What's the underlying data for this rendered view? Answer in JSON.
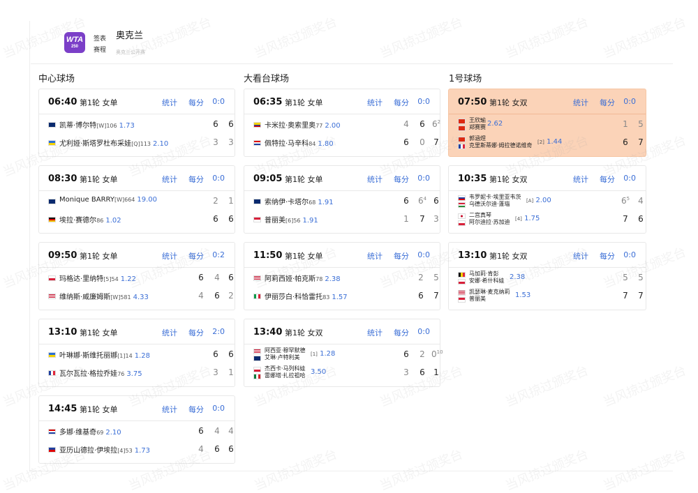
{
  "header": {
    "logo_text": "WTA",
    "logo_sub": "250",
    "nav": [
      "签表",
      "赛程"
    ],
    "title": "奥克兰",
    "subtitle": "奥克兰公开赛"
  },
  "watermark": "当风掠过颁奖台",
  "colors": {
    "link": "#3a6ed6",
    "highlight": "#fbd3b8",
    "logo": "#7b3fc8"
  },
  "links": {
    "stats": "统计",
    "points": "每分"
  },
  "courts": [
    {
      "name": "中心球场",
      "matches": [
        {
          "time": "06:40",
          "round": "第1轮 女单",
          "score": "0:0",
          "p1": {
            "flag": "GB",
            "name": "凯蒂·博尔特",
            "seed": "[W]",
            "rank": "106",
            "odds": "1.73",
            "sets": [
              {
                "v": "6"
              },
              {
                "v": "6"
              }
            ]
          },
          "p2": {
            "flag": "UA",
            "name": "尤利娅·斯塔罗杜布采娃",
            "seed": "[Q]",
            "rank": "113",
            "odds": "2.10",
            "sets": [
              {
                "v": "3",
                "dim": true
              },
              {
                "v": "3",
                "dim": true
              }
            ]
          }
        },
        {
          "time": "08:30",
          "round": "第1轮 女单",
          "score": "0:0",
          "p1": {
            "flag": "NZ",
            "name": "Monique BARRY",
            "seed": "[W]",
            "rank": "664",
            "odds": "19.00",
            "sets": [
              {
                "v": "2",
                "dim": true
              },
              {
                "v": "1",
                "dim": true
              }
            ]
          },
          "p2": {
            "flag": "DE",
            "name": "埃拉·赛德尔",
            "seed": "",
            "rank": "86",
            "odds": "1.02",
            "sets": [
              {
                "v": "6"
              },
              {
                "v": "6"
              }
            ]
          }
        },
        {
          "time": "09:50",
          "round": "第1轮 女单",
          "score": "0:2",
          "p1": {
            "flag": "PL",
            "name": "玛格达·里纳特",
            "seed": "[5]",
            "rank": "54",
            "odds": "1.22",
            "sets": [
              {
                "v": "6"
              },
              {
                "v": "4",
                "dim": true
              },
              {
                "v": "6"
              }
            ]
          },
          "p2": {
            "flag": "US",
            "name": "维纳斯·威廉姆斯",
            "seed": "[W]",
            "rank": "581",
            "odds": "4.33",
            "sets": [
              {
                "v": "4",
                "dim": true
              },
              {
                "v": "6"
              },
              {
                "v": "2",
                "dim": true
              }
            ]
          }
        },
        {
          "time": "13:10",
          "round": "第1轮 女单",
          "score": "2:0",
          "p1": {
            "flag": "UA",
            "name": "叶琳娜·斯维托丽娜",
            "seed": "[1]",
            "rank": "14",
            "odds": "1.28",
            "sets": [
              {
                "v": "6"
              },
              {
                "v": "6"
              }
            ]
          },
          "p2": {
            "flag": "FR",
            "name": "瓦尔瓦拉·格拉乔娃",
            "seed": "",
            "rank": "76",
            "odds": "3.75",
            "sets": [
              {
                "v": "3",
                "dim": true
              },
              {
                "v": "1",
                "dim": true
              }
            ]
          }
        },
        {
          "time": "14:45",
          "round": "第1轮 女单",
          "score": "0:0",
          "p1": {
            "flag": "HR",
            "name": "多娜·维基奇",
            "seed": "",
            "rank": "69",
            "odds": "2.10",
            "sets": [
              {
                "v": "6"
              },
              {
                "v": "4",
                "dim": true
              },
              {
                "v": "4",
                "dim": true
              }
            ]
          },
          "p2": {
            "flag": "PH",
            "name": "亚历山德拉·伊埃拉",
            "seed": "[4]",
            "rank": "53",
            "odds": "1.73",
            "sets": [
              {
                "v": "4",
                "dim": true
              },
              {
                "v": "6"
              },
              {
                "v": "6"
              }
            ]
          }
        }
      ]
    },
    {
      "name": "大看台球场",
      "matches": [
        {
          "time": "06:35",
          "round": "第1轮 女单",
          "score": "0:0",
          "p1": {
            "flag": "CO",
            "name": "卡米拉·奥索里奥",
            "seed": "",
            "rank": "77",
            "odds": "2.00",
            "sets": [
              {
                "v": "4",
                "dim": true
              },
              {
                "v": "6"
              },
              {
                "v": "6",
                "sup": "2",
                "dim": true
              }
            ]
          },
          "p2": {
            "flag": "HR",
            "name": "佩特拉·马辛科",
            "seed": "",
            "rank": "84",
            "odds": "1.80",
            "sets": [
              {
                "v": "6"
              },
              {
                "v": "0",
                "dim": true
              },
              {
                "v": "7"
              }
            ]
          }
        },
        {
          "time": "09:05",
          "round": "第1轮 女单",
          "score": "0:0",
          "p1": {
            "flag": "GB",
            "name": "索纳伊·卡塔尔",
            "seed": "",
            "rank": "68",
            "odds": "1.91",
            "sets": [
              {
                "v": "6"
              },
              {
                "v": "6",
                "sup": "4",
                "dim": true
              },
              {
                "v": "6"
              }
            ]
          },
          "p2": {
            "flag": "ID",
            "name": "普丽美",
            "seed": "[6]",
            "rank": "56",
            "odds": "1.91",
            "sets": [
              {
                "v": "1",
                "dim": true
              },
              {
                "v": "7"
              },
              {
                "v": "3",
                "dim": true
              }
            ]
          }
        },
        {
          "time": "11:50",
          "round": "第1轮 女单",
          "score": "0:0",
          "p1": {
            "flag": "US",
            "name": "阿莉西娅·帕克斯",
            "seed": "",
            "rank": "78",
            "odds": "2.38",
            "sets": [
              {
                "v": "2",
                "dim": true
              },
              {
                "v": "5",
                "dim": true
              }
            ]
          },
          "p2": {
            "flag": "IT",
            "name": "伊丽莎白·科恰雷托",
            "seed": "",
            "rank": "83",
            "odds": "1.57",
            "sets": [
              {
                "v": "6"
              },
              {
                "v": "7"
              }
            ]
          }
        },
        {
          "time": "13:40",
          "round": "第1轮 女双",
          "score": "0:0",
          "doubles": true,
          "p1": {
            "flags": [
              "US",
              "NZ"
            ],
            "names": [
              "阿西亚·穆罕默德",
              "艾琳·卢特利美"
            ],
            "seed": "[1]",
            "odds": "1.28",
            "sets": [
              {
                "v": "6"
              },
              {
                "v": "2",
                "dim": true
              },
              {
                "v": "0",
                "sup": "10",
                "dim": true
              }
            ]
          },
          "p2": {
            "flags": [
              "CZ",
              "MX"
            ],
            "names": [
              "杰西卡·马列科娃",
              "雷娜塔·扎拉祖哈"
            ],
            "seed": "",
            "odds": "3.50",
            "sets": [
              {
                "v": "3",
                "dim": true
              },
              {
                "v": "6"
              },
              {
                "v": "1"
              }
            ]
          }
        }
      ]
    },
    {
      "name": "1号球场",
      "matches": [
        {
          "time": "07:50",
          "round": "第1轮 女双",
          "score": "0:0",
          "doubles": true,
          "highlight": true,
          "p1": {
            "flags": [
              "CN",
              "CN"
            ],
            "names": [
              "王欣瑜",
              "郑赛赛"
            ],
            "seed": "",
            "odds": "2.62",
            "sets": [
              {
                "v": "1",
                "dim": true
              },
              {
                "v": "5",
                "dim": true
              }
            ]
          },
          "p2": {
            "flags": [
              "CN",
              "FR"
            ],
            "names": [
              "郭涵煜",
              "克里斯蒂娜·姆拉德诺维奇"
            ],
            "seed": "[2]",
            "odds": "1.44",
            "sets": [
              {
                "v": "6"
              },
              {
                "v": "7"
              }
            ]
          }
        },
        {
          "time": "10:35",
          "round": "第1轮 女双",
          "score": "0:0",
          "doubles": true,
          "p1": {
            "flags": [
              "SI",
              "HU"
            ],
            "names": [
              "韦罗妮卡·埃里亚韦茨",
              "乌德沃尔迪·蓬瑙"
            ],
            "seed": "[A]",
            "odds": "2.00",
            "sets": [
              {
                "v": "6",
                "sup": "5",
                "dim": true
              },
              {
                "v": "4",
                "dim": true
              }
            ]
          },
          "p2": {
            "flags": [
              "JP",
              "PL"
            ],
            "names": [
              "二宫真琴",
              "阿尔迪拉·苏加迪"
            ],
            "seed": "[4]",
            "odds": "1.75",
            "sets": [
              {
                "v": "7"
              },
              {
                "v": "6"
              }
            ]
          }
        },
        {
          "time": "13:10",
          "round": "第1轮 女双",
          "score": "0:0",
          "doubles": true,
          "p1": {
            "flags": [
              "BE",
              "CZ"
            ],
            "names": [
              "马加莉·肯彭",
              "安娜·希什科娃"
            ],
            "seed": "",
            "odds": "2.38",
            "sets": [
              {
                "v": "5",
                "dim": true
              },
              {
                "v": "5",
                "dim": true
              }
            ]
          },
          "p2": {
            "flags": [
              "US",
              "ID"
            ],
            "names": [
              "凯瑟琳·麦克纳莉",
              "普丽美"
            ],
            "seed": "",
            "odds": "1.53",
            "sets": [
              {
                "v": "7"
              },
              {
                "v": "7"
              }
            ]
          }
        }
      ]
    }
  ]
}
